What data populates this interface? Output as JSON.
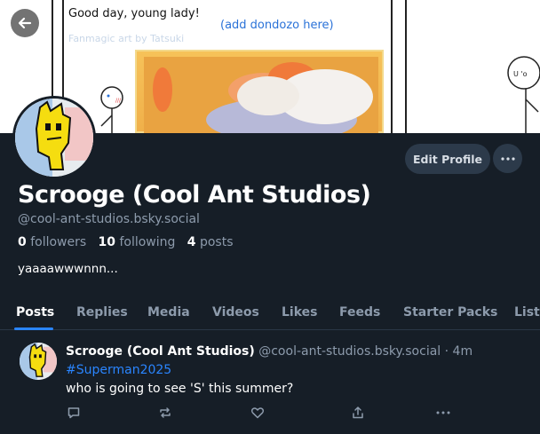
{
  "banner": {
    "speech_left": "Good day, young lady!",
    "speech_right": "(add dondozo here)",
    "faint_credit": "Fanmagic art by Tatsuki"
  },
  "nav": {
    "back_icon": "arrow-left-icon"
  },
  "profile": {
    "display_name": "Scrooge (Cool Ant Studios)",
    "handle": "@cool-ant-studios.bsky.social",
    "followers_count": "0",
    "followers_label": "followers",
    "following_count": "10",
    "following_label": "following",
    "posts_count": "4",
    "posts_label": "posts",
    "bio": "yaaaawwwnnn..."
  },
  "actions": {
    "edit_profile": "Edit Profile",
    "more_icon": "ellipsis-icon"
  },
  "tabs": [
    {
      "label": "Posts",
      "active": true
    },
    {
      "label": "Replies"
    },
    {
      "label": "Media"
    },
    {
      "label": "Videos"
    },
    {
      "label": "Likes"
    },
    {
      "label": "Feeds"
    },
    {
      "label": "Starter Packs"
    },
    {
      "label": "List"
    }
  ],
  "post": {
    "author_name": "Scrooge (Cool Ant Studios)",
    "author_handle": "@cool-ant-studios.bsky.social",
    "separator": "·",
    "time": "4m",
    "hashtag": "#Superman2025",
    "text": "who is going to see 'S' this summer?",
    "action_icons": [
      "reply-icon",
      "repost-icon",
      "like-icon",
      "share-icon",
      "more-icon"
    ]
  },
  "colors": {
    "background": "#161e27",
    "accent": "#2a85ff",
    "muted_text": "#8d9bac",
    "button_bg": "#2c3a4a"
  }
}
